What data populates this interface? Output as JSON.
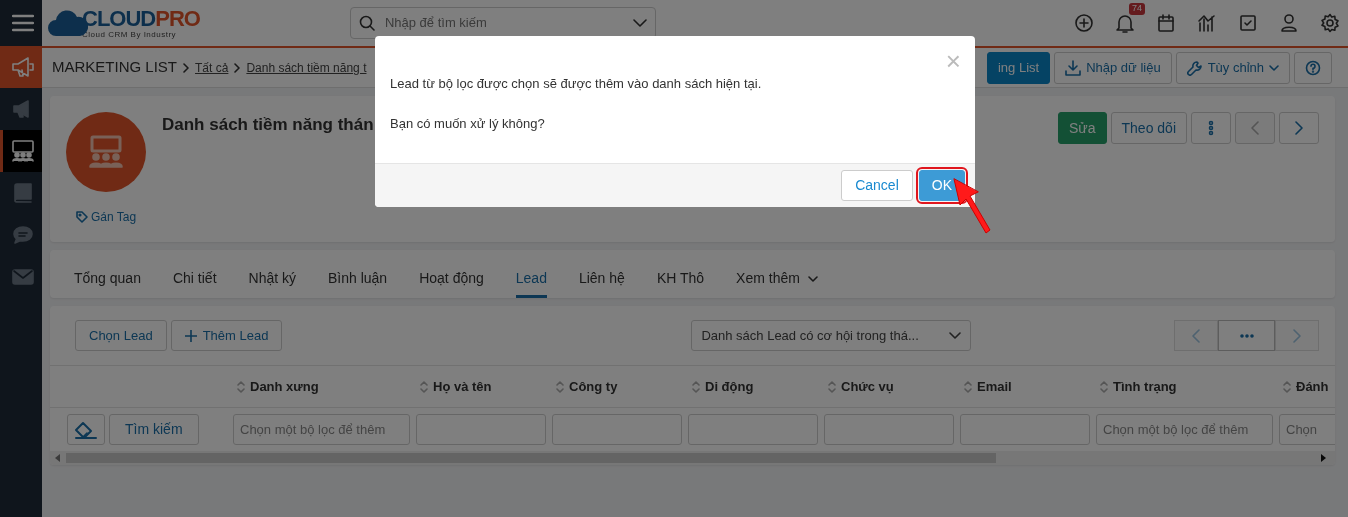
{
  "sidebar": {
    "items": [
      {
        "kind": "toggle",
        "selected": false
      },
      {
        "kind": "module",
        "selected": false
      },
      {
        "kind": "link",
        "selected": false
      },
      {
        "kind": "link",
        "selected": true
      },
      {
        "kind": "link",
        "selected": false
      },
      {
        "kind": "link",
        "selected": false
      },
      {
        "kind": "link",
        "selected": false
      }
    ]
  },
  "topbar": {
    "logo": {
      "parts": [
        "CLOUD",
        "PRO"
      ],
      "tagline": "Cloud CRM By Industry"
    },
    "search": {
      "placeholder": "Nhập để tìm kiếm"
    },
    "notification_count": "74"
  },
  "breadcrumb": [
    "MARKETING LIST",
    "Tất cả",
    "Danh sách tiềm năng t"
  ],
  "toolbar_buttons": [
    {
      "kind": "primary",
      "label": "ing List"
    },
    {
      "kind": "import",
      "label": "Nhập dữ liệu"
    },
    {
      "kind": "dropdown",
      "label": "Tùy chỉnh"
    },
    {
      "kind": "help"
    }
  ],
  "record": {
    "title": "Danh sách tiềm năng thán",
    "tag_link": "Gán Tag",
    "buttons": [
      {
        "kind": "edit",
        "label": "Sửa",
        "disabled": false
      },
      {
        "kind": "text",
        "label": "Theo dõi",
        "disabled": false
      },
      {
        "kind": "more",
        "disabled": false
      },
      {
        "kind": "prev",
        "disabled": true
      },
      {
        "kind": "next",
        "disabled": false
      }
    ]
  },
  "tabs": [
    {
      "label": "Tổng quan",
      "selected": false
    },
    {
      "label": "Chi tiết",
      "selected": false
    },
    {
      "label": "Nhật ký",
      "selected": false
    },
    {
      "label": "Bình luận",
      "selected": false
    },
    {
      "label": "Hoạt động",
      "selected": false
    },
    {
      "label": "Lead",
      "selected": true
    },
    {
      "label": "Liên hệ",
      "selected": false
    },
    {
      "label": "KH Thô",
      "selected": false
    },
    {
      "label": "Xem thêm",
      "selected": false,
      "dropdown": true
    }
  ],
  "lead_panel": {
    "buttons": [
      {
        "kind": "plain",
        "label": "Chọn Lead"
      },
      {
        "kind": "add",
        "label": "Thêm Lead"
      }
    ],
    "filter_select": "Danh sách Lead có cơ hội trong thá...",
    "pager": [
      {
        "kind": "prev",
        "disabled": true
      },
      {
        "kind": "more",
        "disabled": false
      },
      {
        "kind": "next",
        "disabled": true
      }
    ],
    "search_button": "Tìm kiếm",
    "columns": [
      {
        "label": "Danh xưng",
        "placeholder": "Chọn một bộ lọc để thêm"
      },
      {
        "label": "Họ và tên"
      },
      {
        "label": "Công ty"
      },
      {
        "label": "Di động"
      },
      {
        "label": "Chức vụ"
      },
      {
        "label": "Email"
      },
      {
        "label": "Tình trạng",
        "placeholder": "Chọn một bộ lọc để thêm"
      },
      {
        "label": "Đánh",
        "placeholder": "Chọn"
      }
    ]
  },
  "dialog": {
    "messages": [
      "Lead từ bộ lọc được chọn sẽ được thêm vào danh sách hiện tại.",
      "Bạn có muốn xử lý không?"
    ],
    "close": "×",
    "buttons": [
      {
        "kind": "cancel",
        "label": "Cancel",
        "highlighted": false
      },
      {
        "kind": "ok",
        "label": "OK",
        "highlighted": true
      }
    ]
  }
}
